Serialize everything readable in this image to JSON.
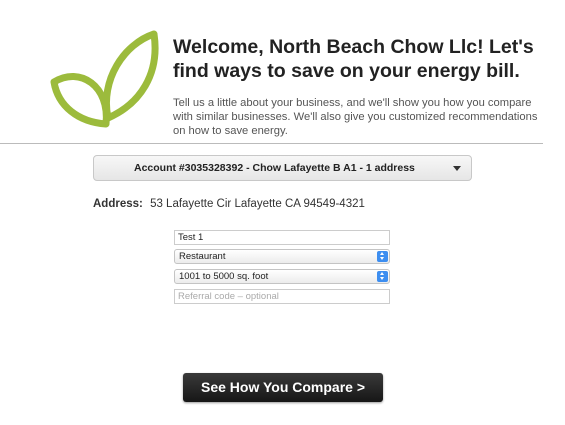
{
  "brand": {
    "logo_icon": "leaf-sprout-icon",
    "leaf_color": "#9cbb3c"
  },
  "header": {
    "welcome": "Welcome, North Beach Chow Llc! Let's find ways to save on your energy bill.",
    "intro": "Tell us a little about your business, and we'll show you how you compare with similar businesses. We'll also give you customized recommendations on how to save energy."
  },
  "account": {
    "selected": "Account #3035328392 - Chow Lafayette B A1 - 1 address",
    "caret_icon": "caret-down-icon"
  },
  "address": {
    "label": "Address:",
    "value": "53 Lafayette Cir Lafayette CA 94549-4321"
  },
  "form": {
    "business_name": "Test 1",
    "business_type": "Restaurant",
    "business_size": "1001 to 5000 sq. foot",
    "referral_placeholder": "Referral code – optional",
    "select_icon": "select-stepper-icon"
  },
  "cta": {
    "label": "See How You Compare >"
  },
  "colors": {
    "button_bg": "#1f1f1f",
    "stepper_blue": "#3d8ef0"
  }
}
